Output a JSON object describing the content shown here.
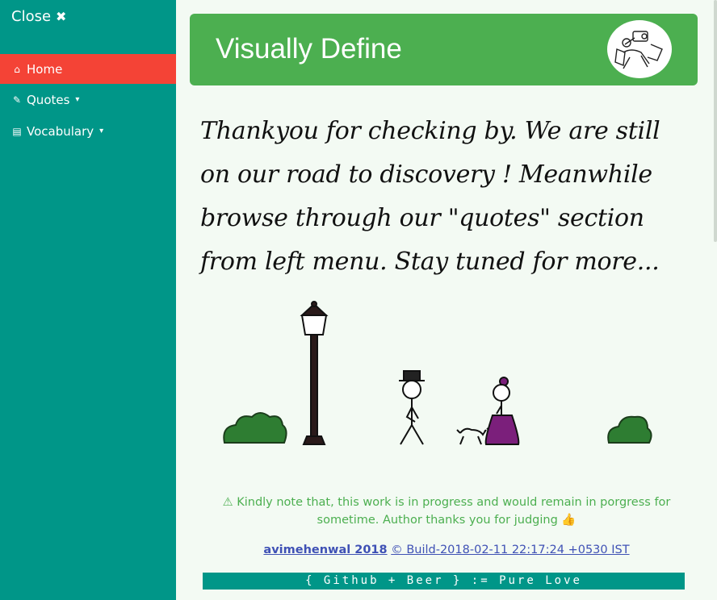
{
  "sidebar": {
    "close_label": "Close",
    "close_icon": "✖",
    "items": [
      {
        "label": "Home",
        "icon": "home-icon",
        "glyph": "⌂",
        "active": true
      },
      {
        "label": "Quotes",
        "icon": "pencil-icon",
        "glyph": "✎",
        "dropdown": true
      },
      {
        "label": "Vocabulary",
        "icon": "book-icon",
        "glyph": "▤",
        "dropdown": true
      }
    ],
    "caret": "▾"
  },
  "header": {
    "title": "Visually Define"
  },
  "main": {
    "message": "Thankyou for checking by. We are still on our road to discovery ! Meanwhile browse through our \"quotes\" section from left menu. Stay tuned for more...",
    "notice_icon": "⚠",
    "notice": "Kindly note that, this work is in progress and would remain in porgress for sometime. Author thanks you for judging",
    "thumbs_icon": "👍",
    "author": "avimehenwal 2018",
    "build": "© Build-2018-02-11 22:17:24 +0530 IST",
    "footer": "{ Github + Beer } := Pure Love"
  },
  "colors": {
    "sidebar": "#009688",
    "active": "#f44336",
    "header": "#4caf50",
    "link": "#3f51b5",
    "background": "#f3faf3"
  }
}
